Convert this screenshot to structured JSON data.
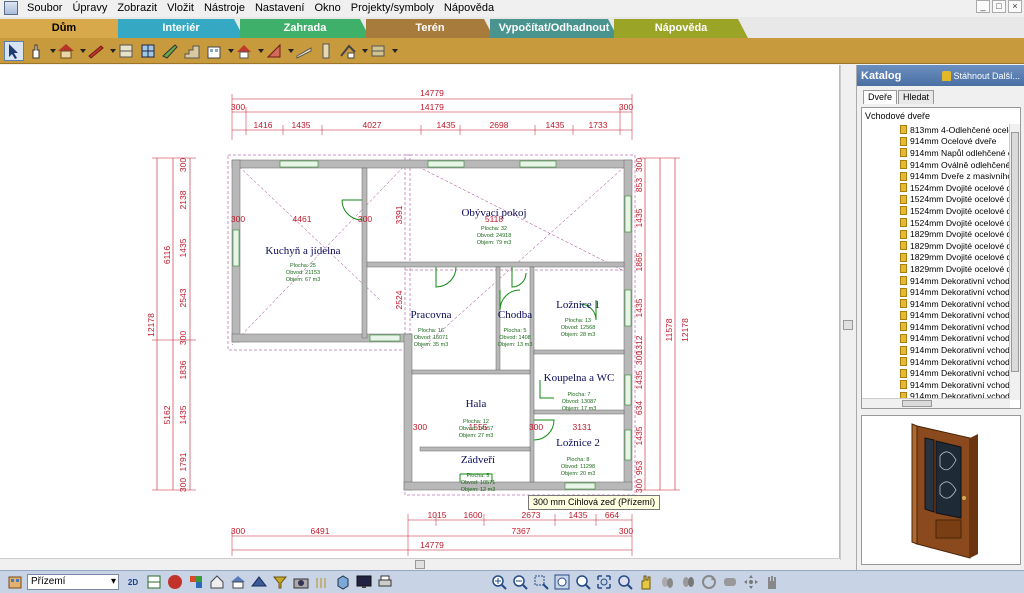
{
  "menu": {
    "items": [
      "Soubor",
      "Úpravy",
      "Zobrazit",
      "Vložit",
      "Nástroje",
      "Nastavení",
      "Okno",
      "Projekty/symboly",
      "Nápověda"
    ]
  },
  "window_controls": [
    "_",
    "□",
    "×"
  ],
  "tabs": [
    {
      "label": "Dům",
      "color": "#d8a94a",
      "active": true
    },
    {
      "label": "Interiér",
      "color": "#35a9c4",
      "active": false
    },
    {
      "label": "Zahrada",
      "color": "#3fb06a",
      "active": false
    },
    {
      "label": "Terén",
      "color": "#a77b3c",
      "active": false
    },
    {
      "label": "Vypočítat/Odhadnout",
      "color": "#4a9490",
      "active": false
    },
    {
      "label": "Nápověda",
      "color": "#9aa528",
      "active": false
    }
  ],
  "toolbar": {
    "icons": [
      "select-arrow-icon",
      "hand-tool-icon",
      "house-roof-icon",
      "wall-icon",
      "wall-segment-icon",
      "window-icon",
      "wall-paint-icon",
      "stairs-icon",
      "building-icon",
      "roof-icon",
      "roof-slope-icon",
      "fence-icon",
      "column-icon",
      "dimension-icon",
      "material-icon"
    ]
  },
  "floorplan": {
    "top_dims_total": [
      "14779",
      "14179"
    ],
    "top_dims_segments": [
      "300",
      "1416",
      "1435",
      "4027",
      "1435",
      "2698",
      "1435",
      "1733",
      "300"
    ],
    "bottom_dims_segments": [
      "1015",
      "1600",
      "2673",
      "1435",
      "664"
    ],
    "bottom_dims_row2": [
      "300",
      "6491",
      "7367",
      "300"
    ],
    "bottom_dims_total": "14779",
    "left_dims": [
      "300",
      "2138",
      "1435",
      "2543",
      "300",
      "1836",
      "1435",
      "1791",
      "300"
    ],
    "left_totals": [
      "6116",
      "5162",
      "12178"
    ],
    "right_dims": [
      "300",
      "853",
      "1435",
      "1865",
      "1435",
      "1312",
      "300",
      "1435",
      "634",
      "1435",
      "953",
      "300"
    ],
    "right_totals": [
      "11578",
      "12178"
    ],
    "inner_dims": [
      "4461",
      "3391",
      "2524",
      "300",
      "300",
      "5118",
      "3131",
      "300",
      "1555",
      "300"
    ],
    "rooms": [
      {
        "name": "Kuchyň a jídelna",
        "lines": [
          "Plocha: 25",
          "Obvod: 21153",
          "Objem: 67 m3"
        ]
      },
      {
        "name": "Obývací pokoj",
        "lines": [
          "Plocha: 32",
          "Obvod: 24918",
          "Objem: 79 m3"
        ]
      },
      {
        "name": "Pracovna",
        "lines": [
          "Plocha: 16",
          "Obvod: 16071",
          "Objem: 35 m3"
        ]
      },
      {
        "name": "Chodba",
        "lines": [
          "Plocha: 5",
          "Obvod: 1408",
          "Objem: 13 m3"
        ]
      },
      {
        "name": "Ložnice 1",
        "lines": [
          "Plocha: 13",
          "Obvod: 12568",
          "Objem: 28 m3"
        ]
      },
      {
        "name": "Koupelna a WC",
        "lines": [
          "Plocha: 7",
          "Obvod: 13087",
          "Objem: 17 m3"
        ]
      },
      {
        "name": "Hala",
        "lines": [
          "Plocha: 12",
          "Obvod: 14157",
          "Objem: 27 m3"
        ]
      },
      {
        "name": "Ložnice 2",
        "lines": [
          "Plocha: 8",
          "Obvod: 11298",
          "Objem: 20 m3"
        ]
      },
      {
        "name": "Zádveří",
        "lines": [
          "Plocha: 5",
          "Obvod: 10571",
          "Objem: 12 m3"
        ]
      }
    ]
  },
  "tooltip": "300 mm Cihlová zeď (Přízemí)",
  "catalog": {
    "title": "Katalog",
    "download_label": "Stáhnout Další...",
    "tabs": [
      "Dveře",
      "Hledat"
    ],
    "group": "Vchodové dveře",
    "items": [
      "813mm 4-Odlehčené ocelové",
      "914mm Ocelové dveře",
      "914mm Napůl odlehčené ocel",
      "914mm Oválně odlehčené oc",
      "914mm Dveře z masivního dř",
      "1524mm Dvojité ocelové dve",
      "1524mm Dvojité ocelové dve",
      "1524mm Dvojité ocelové dve",
      "1524mm Dvojité ocelové dve",
      "1829mm Dvojité ocelové dve",
      "1829mm Dvojité ocelové dve",
      "1829mm Dvojité ocelové dve",
      "1829mm Dvojité ocelové dve",
      "914mm Dekorativní vchodové",
      "914mm Dekorativní vchodové",
      "914mm Dekorativní vchodové",
      "914mm Dekorativní vchodové",
      "914mm Dekorativní vchodové",
      "914mm Dekorativní vchodové",
      "914mm Dekorativní vchodové",
      "914mm Dekorativní vchodové",
      "914mm Dekorativní vchodové",
      "914mm Dekorativní vchodové",
      "914mm Dekorativní vchodové"
    ]
  },
  "bottombar": {
    "floor": "Přízemí",
    "view_2d": "2D",
    "view_3d": "3D"
  }
}
